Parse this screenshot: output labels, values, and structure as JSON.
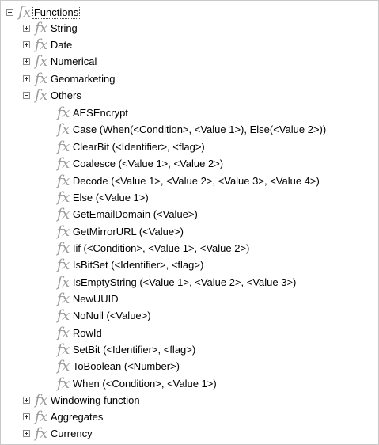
{
  "tree": {
    "root": {
      "label": "Functions",
      "icon": "fx-icon",
      "expanded": true
    },
    "categories": [
      {
        "label": "String"
      },
      {
        "label": "Date"
      },
      {
        "label": "Numerical"
      },
      {
        "label": "Geomarketing"
      },
      {
        "label": "Others"
      },
      {
        "label": "Windowing function"
      },
      {
        "label": "Aggregates"
      },
      {
        "label": "Currency"
      }
    ],
    "others_items": [
      {
        "label": "AESEncrypt"
      },
      {
        "label": "Case (When(<Condition>, <Value 1>), Else(<Value 2>))"
      },
      {
        "label": "ClearBit (<Identifier>, <flag>)"
      },
      {
        "label": "Coalesce (<Value 1>, <Value 2>)"
      },
      {
        "label": "Decode (<Value 1>, <Value 2>, <Value 3>, <Value 4>)"
      },
      {
        "label": "Else (<Value 1>)"
      },
      {
        "label": "GetEmailDomain (<Value>)"
      },
      {
        "label": "GetMirrorURL (<Value>)"
      },
      {
        "label": "Iif (<Condition>, <Value 1>, <Value 2>)"
      },
      {
        "label": "IsBitSet (<Identifier>, <flag>)"
      },
      {
        "label": "IsEmptyString (<Value 1>, <Value 2>, <Value 3>)"
      },
      {
        "label": "NewUUID"
      },
      {
        "label": "NoNull (<Value>)"
      },
      {
        "label": "RowId"
      },
      {
        "label": "SetBit (<Identifier>, <flag>)"
      },
      {
        "label": "ToBoolean (<Number>)"
      },
      {
        "label": "When (<Condition>, <Value 1>)"
      }
    ],
    "fx_glyph": "fx"
  }
}
